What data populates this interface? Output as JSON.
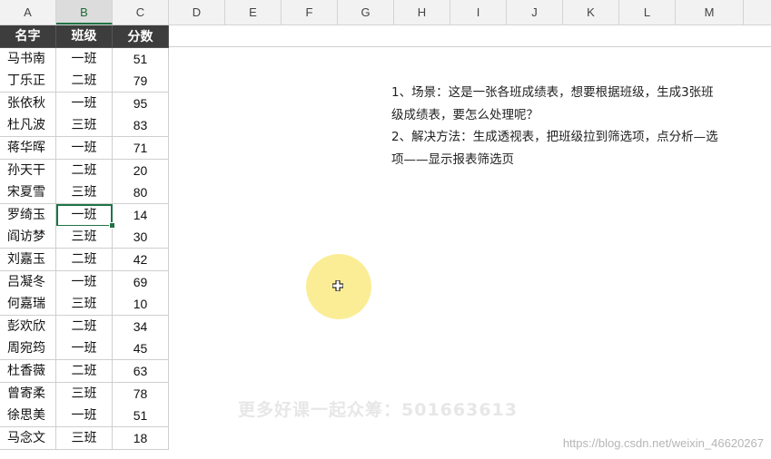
{
  "columns": [
    "A",
    "B",
    "C",
    "D",
    "E",
    "F",
    "G",
    "H",
    "I",
    "J",
    "K",
    "L",
    "M"
  ],
  "table": {
    "headers": [
      "名字",
      "班级",
      "分数"
    ],
    "rows": [
      [
        "马书南",
        "一班",
        "51"
      ],
      [
        "丁乐正",
        "二班",
        "79"
      ],
      [
        "张依秋",
        "一班",
        "95"
      ],
      [
        "杜凡波",
        "三班",
        "83"
      ],
      [
        "蒋华晖",
        "一班",
        "71"
      ],
      [
        "孙天干",
        "二班",
        "20"
      ],
      [
        "宋夏雪",
        "三班",
        "80"
      ],
      [
        "罗绮玉",
        "一班",
        "14"
      ],
      [
        "阎访梦",
        "三班",
        "30"
      ],
      [
        "刘嘉玉",
        "二班",
        "42"
      ],
      [
        "吕凝冬",
        "一班",
        "69"
      ],
      [
        "何嘉瑞",
        "三班",
        "10"
      ],
      [
        "彭欢欣",
        "二班",
        "34"
      ],
      [
        "周宛筠",
        "一班",
        "45"
      ],
      [
        "杜香薇",
        "二班",
        "63"
      ],
      [
        "曾寄柔",
        "三班",
        "78"
      ],
      [
        "徐思美",
        "一班",
        "51"
      ],
      [
        "马念文",
        "三班",
        "18"
      ]
    ]
  },
  "note": {
    "line1": "1、场景：这是一张各班成绩表，想要根据班级，生成3张班",
    "line2": "级成绩表，要怎么处理呢？",
    "line3": "2、解决方法：生成透视表，把班级拉到筛选项，点分析—选",
    "line4": "项——显示报表筛选页"
  },
  "watermarks": {
    "center": "更多好课一起众筹：501663613",
    "corner": "https://blog.csdn.net/weixin_46620267"
  },
  "colors": {
    "accent": "#217346",
    "header_bg": "#3d3d3d",
    "highlight": "#fae66e"
  },
  "active_cell": "B8"
}
